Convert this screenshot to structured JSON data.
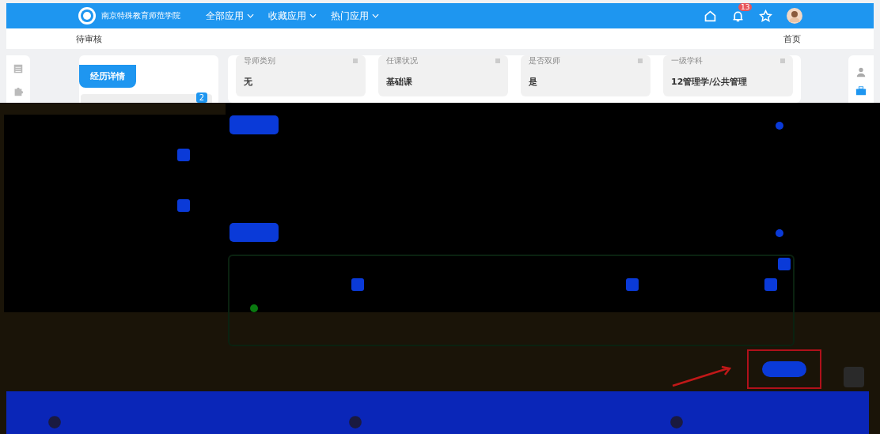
{
  "header": {
    "school_name": "南京特殊教育师范学院",
    "nav": [
      {
        "label": "全部应用"
      },
      {
        "label": "收藏应用"
      },
      {
        "label": "热门应用"
      }
    ],
    "notification_count": "13"
  },
  "breadcrumb": {
    "title": "待审核",
    "home": "首页"
  },
  "side_panel": {
    "tab": "经历详情",
    "item_badge": "2"
  },
  "info_cards": [
    {
      "label": "导师类别",
      "value": "无"
    },
    {
      "label": "任课状况",
      "value": "基础课"
    },
    {
      "label": "是否双师",
      "value": "是"
    },
    {
      "label": "一级学科",
      "value": "12管理学/公共管理"
    }
  ]
}
